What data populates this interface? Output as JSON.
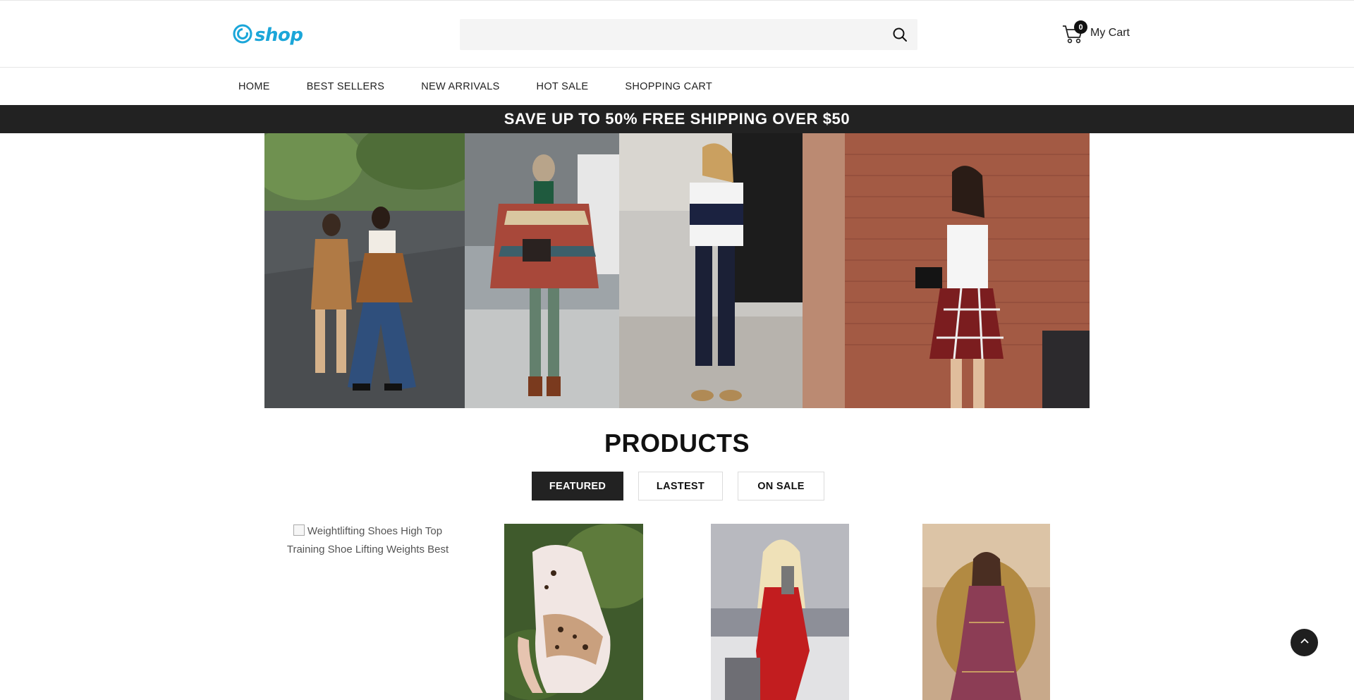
{
  "header": {
    "logo_text": "shop",
    "search": {
      "value": "",
      "placeholder": ""
    },
    "cart": {
      "count": "0",
      "label": "My Cart"
    }
  },
  "nav": {
    "items": [
      {
        "label": "HOME"
      },
      {
        "label": "BEST SELLERS"
      },
      {
        "label": "NEW ARRIVALS"
      },
      {
        "label": "HOT SALE"
      },
      {
        "label": "SHOPPING CART"
      }
    ]
  },
  "promo": {
    "text": "SAVE UP TO 50% FREE SHIPPING OVER $50"
  },
  "products": {
    "title": "PRODUCTS",
    "tabs": [
      {
        "label": "FEATURED",
        "active": true
      },
      {
        "label": "LASTEST",
        "active": false
      },
      {
        "label": "ON SALE",
        "active": false
      }
    ],
    "items": [
      {
        "alt": "Weightlifting Shoes High Top Training Shoe Lifting Weights Best"
      }
    ]
  },
  "colors": {
    "brand": "#1ba6d9",
    "dark": "#222222",
    "search_bg": "#f4f4f4"
  },
  "icons": [
    "search-icon",
    "cart-icon",
    "chevron-up-icon",
    "logo-swirl-icon"
  ]
}
